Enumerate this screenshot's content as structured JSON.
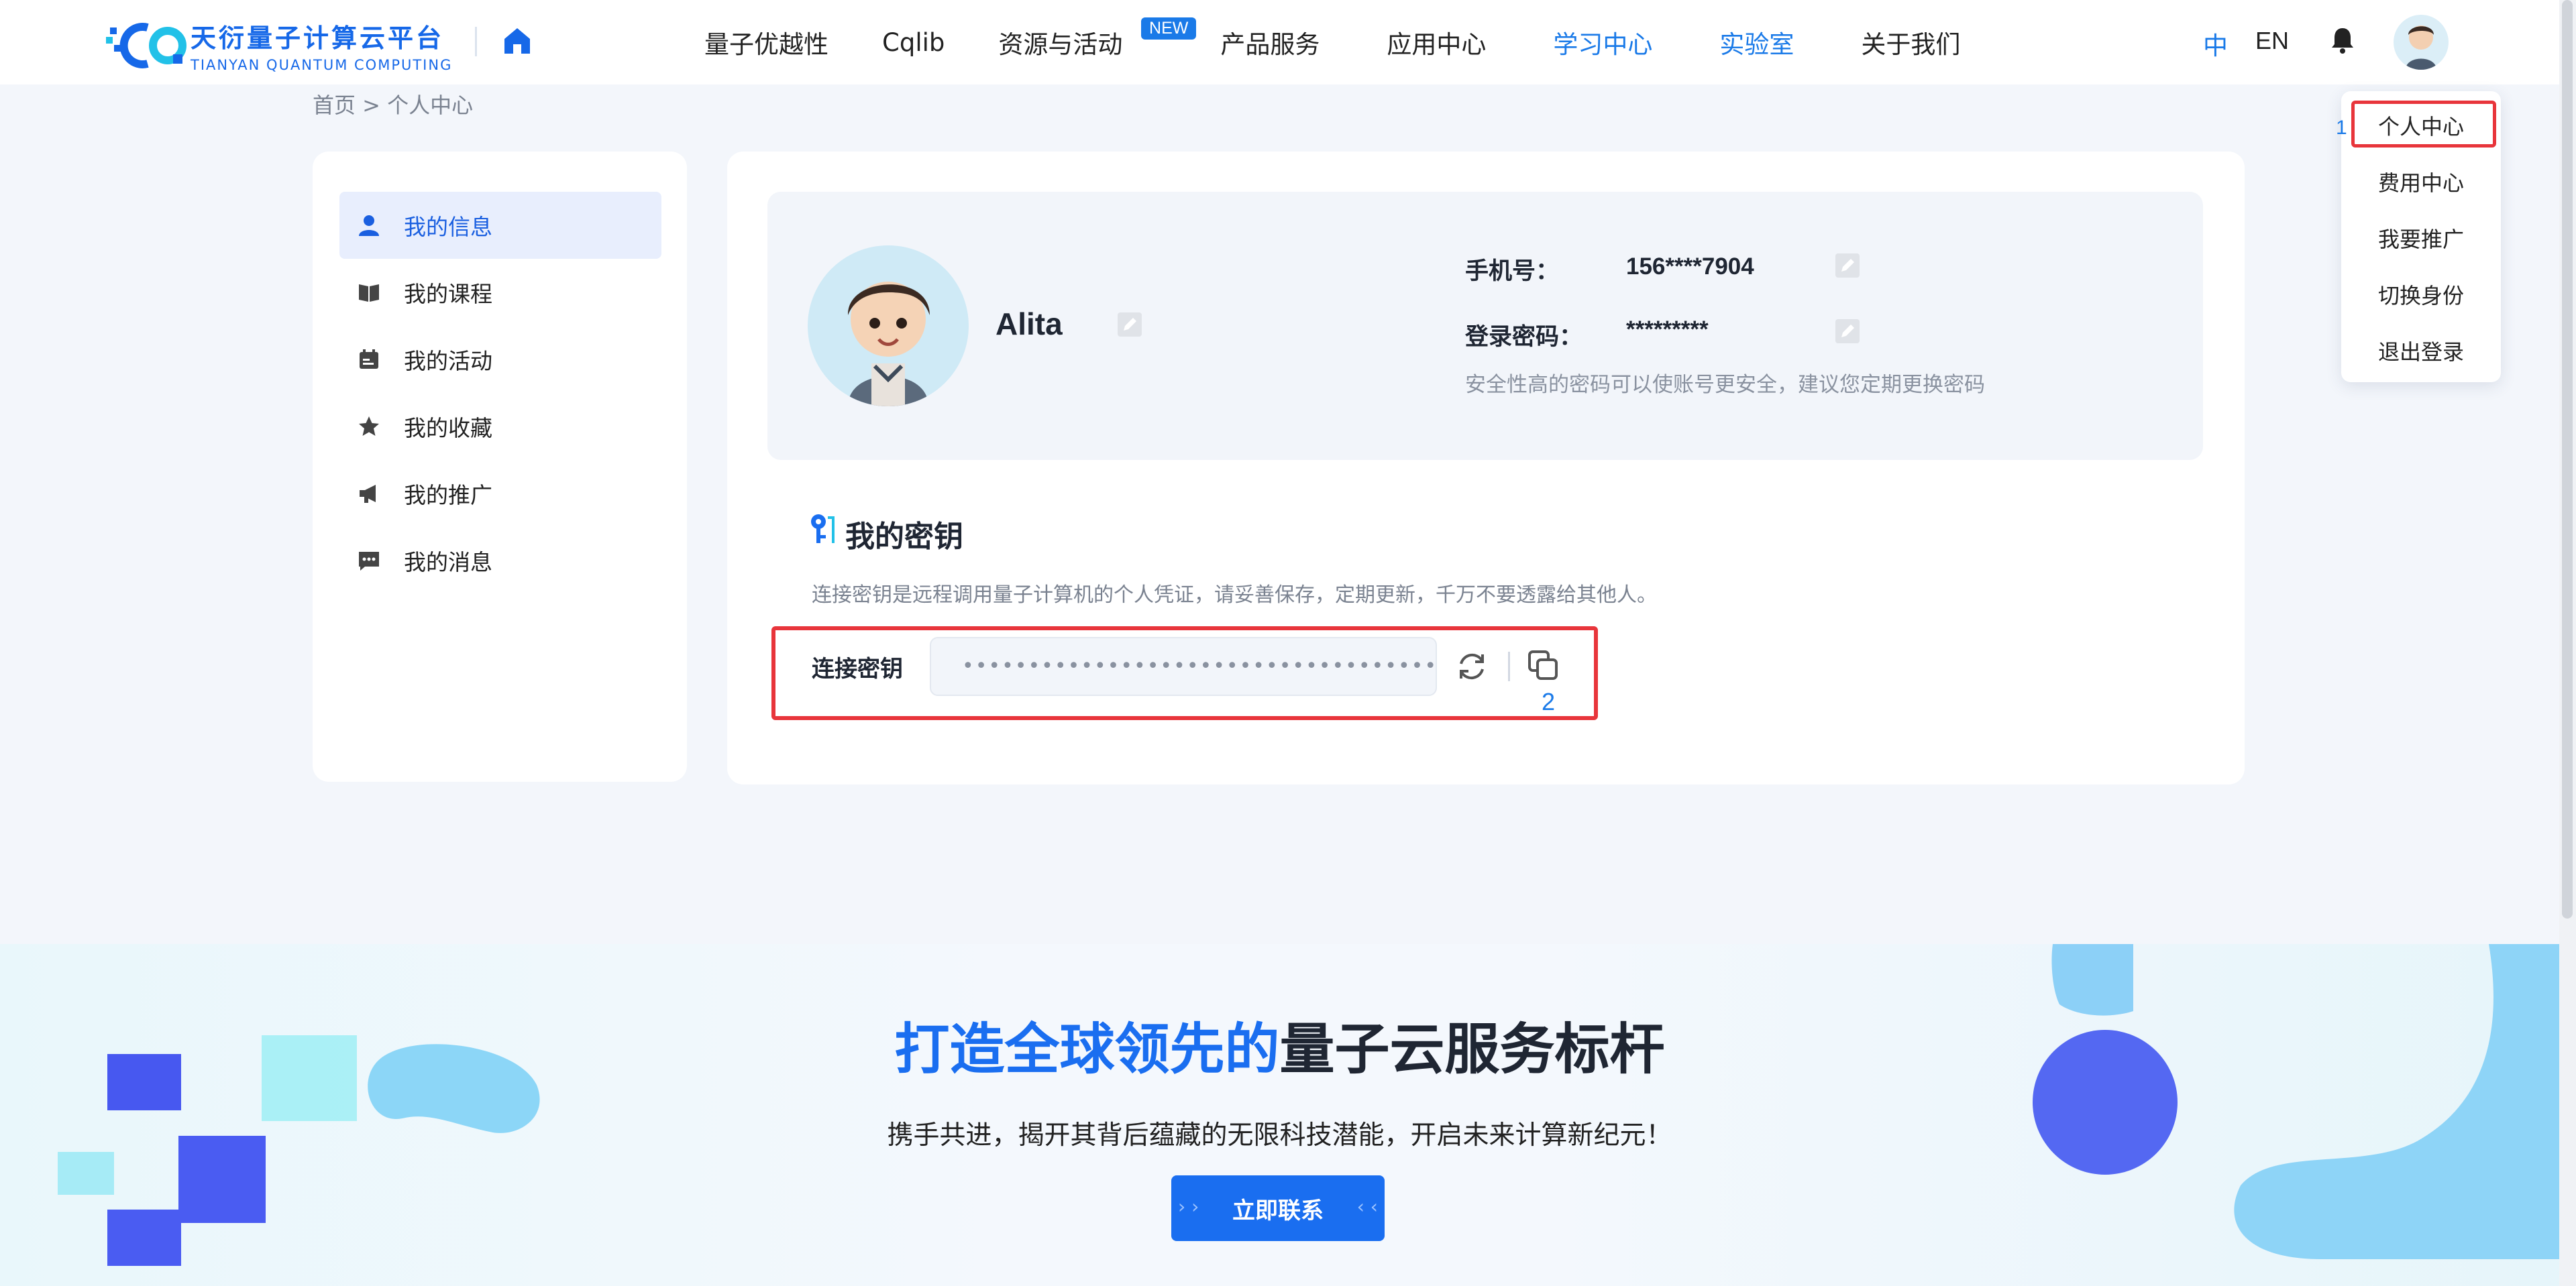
{
  "header": {
    "logo_cn": "天衍量子计算云平台",
    "logo_en": "TIANYAN QUANTUM COMPUTING",
    "nav": [
      {
        "label": "量子优越性",
        "active": false
      },
      {
        "label": "Cqlib",
        "active": false
      },
      {
        "label": "资源与活动",
        "active": false,
        "badge": "NEW"
      },
      {
        "label": "产品服务",
        "active": false
      },
      {
        "label": "应用中心",
        "active": false
      },
      {
        "label": "学习中心",
        "active": true
      },
      {
        "label": "实验室",
        "active": true
      },
      {
        "label": "关于我们",
        "active": false
      }
    ],
    "lang_zh": "中",
    "lang_en": "EN"
  },
  "breadcrumb": "首页 > 个人中心",
  "dropdown": {
    "items": [
      "个人中心",
      "费用中心",
      "我要推广",
      "切换身份",
      "退出登录"
    ],
    "marker": "1"
  },
  "sidebar": {
    "items": [
      {
        "label": "我的信息",
        "icon": "user-icon",
        "active": true
      },
      {
        "label": "我的课程",
        "icon": "book-icon",
        "active": false
      },
      {
        "label": "我的活动",
        "icon": "calendar-icon",
        "active": false
      },
      {
        "label": "我的收藏",
        "icon": "star-icon",
        "active": false
      },
      {
        "label": "我的推广",
        "icon": "megaphone-icon",
        "active": false
      },
      {
        "label": "我的消息",
        "icon": "message-icon",
        "active": false
      }
    ]
  },
  "profile": {
    "username": "Alita",
    "phone_label": "手机号：",
    "phone_value": "156****7904",
    "password_label": "登录密码：",
    "password_value": "*********",
    "password_hint": "安全性高的密码可以使账号更安全，建议您定期更换密码"
  },
  "key": {
    "title": "我的密钥",
    "description": "连接密钥是远程调用量子计算机的个人凭证，请妥善保存，定期更新，千万不要透露给其他人。",
    "label": "连接密钥",
    "value": "••••••••••••••••••••••••••••••••••••••",
    "marker": "2"
  },
  "banner": {
    "title_highlight": "打造全球领先的",
    "title_rest": "量子云服务标杆",
    "subtitle": "携手共进，揭开其背后蕴藏的无限科技潜能，开启未来计算新纪元！",
    "button": "立即联系"
  },
  "colors": {
    "accent": "#1a6ef0",
    "highlight_border": "#e8353b"
  }
}
